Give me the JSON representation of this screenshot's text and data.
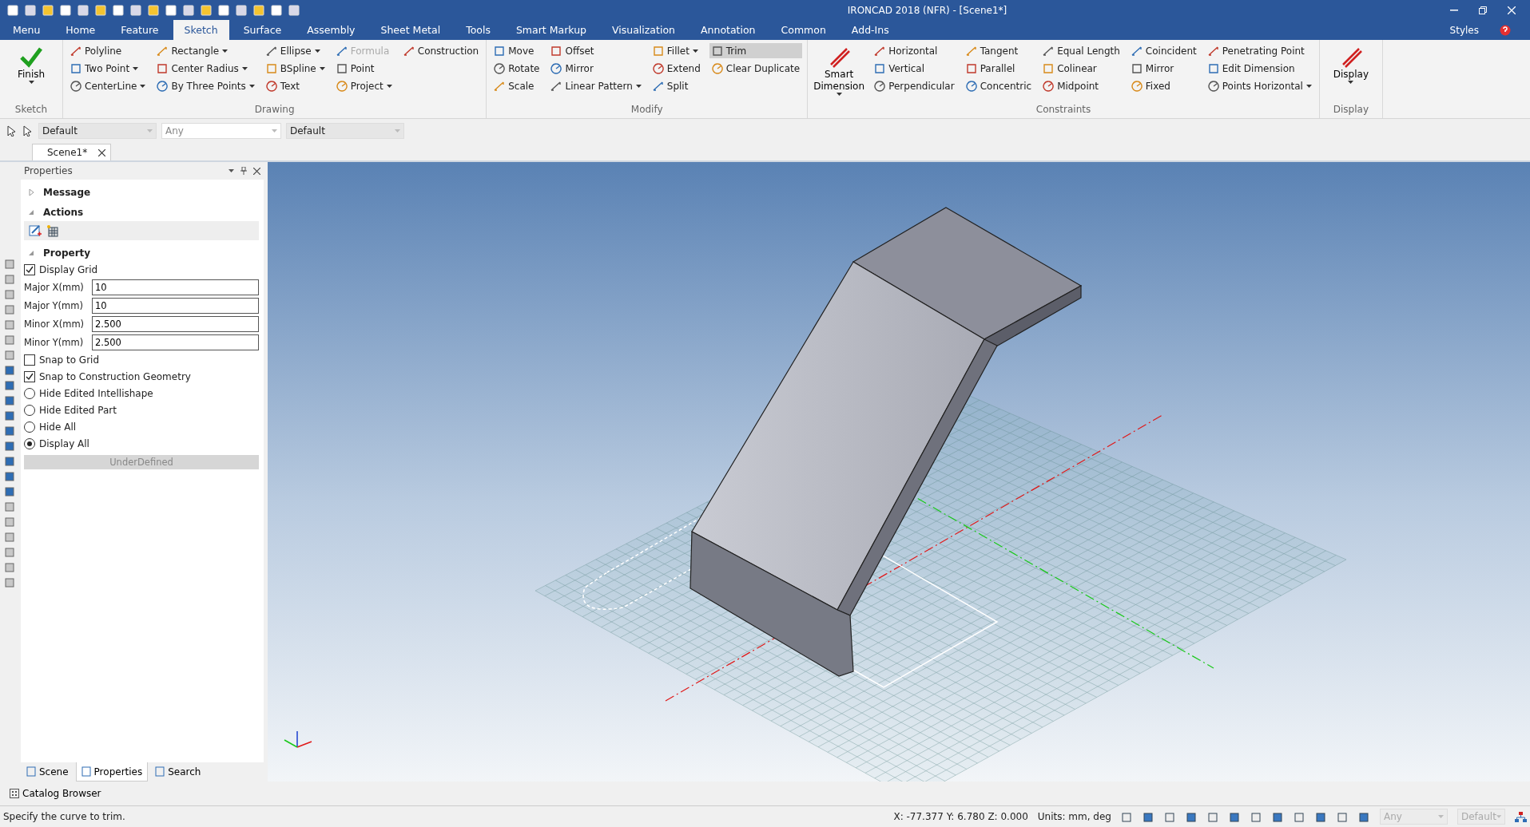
{
  "window": {
    "title": "IRONCAD 2018 (NFR) - [Scene1*]"
  },
  "menu_tabs": [
    {
      "label": "Menu",
      "selected": false
    },
    {
      "label": "Home",
      "selected": false
    },
    {
      "label": "Feature",
      "selected": false
    },
    {
      "label": "Sketch",
      "selected": true
    },
    {
      "label": "Surface",
      "selected": false
    },
    {
      "label": "Assembly",
      "selected": false
    },
    {
      "label": "Sheet Metal",
      "selected": false
    },
    {
      "label": "Tools",
      "selected": false
    },
    {
      "label": "Smart Markup",
      "selected": false
    },
    {
      "label": "Visualization",
      "selected": false
    },
    {
      "label": "Annotation",
      "selected": false
    },
    {
      "label": "Common",
      "selected": false
    },
    {
      "label": "Add-Ins",
      "selected": false
    }
  ],
  "styles_menu": {
    "label": "Styles"
  },
  "ribbon": [
    {
      "label": "Sketch",
      "columns": [
        {
          "kind": "large",
          "label": "Finish",
          "dropdown": true
        }
      ]
    },
    {
      "label": "Drawing",
      "columns": [
        {
          "kind": "stack",
          "items": [
            {
              "label": "Polyline",
              "dropdown": false,
              "disabled": false,
              "selected": false
            },
            {
              "label": "Two Point",
              "dropdown": true,
              "disabled": false,
              "selected": false
            },
            {
              "label": "CenterLine",
              "dropdown": true,
              "disabled": false,
              "selected": false
            }
          ]
        },
        {
          "kind": "stack",
          "items": [
            {
              "label": "Rectangle",
              "dropdown": true,
              "disabled": false,
              "selected": false
            },
            {
              "label": "Center Radius",
              "dropdown": true,
              "disabled": false,
              "selected": false
            },
            {
              "label": "By Three Points",
              "dropdown": true,
              "disabled": false,
              "selected": false
            }
          ]
        },
        {
          "kind": "stack",
          "items": [
            {
              "label": "Ellipse",
              "dropdown": true,
              "disabled": false,
              "selected": false
            },
            {
              "label": "BSpline",
              "dropdown": true,
              "disabled": false,
              "selected": false
            },
            {
              "label": "Text",
              "dropdown": false,
              "disabled": false,
              "selected": false
            }
          ]
        },
        {
          "kind": "stack",
          "items": [
            {
              "label": "Formula",
              "dropdown": false,
              "disabled": true,
              "selected": false
            },
            {
              "label": "Point",
              "dropdown": false,
              "disabled": false,
              "selected": false
            },
            {
              "label": "Project",
              "dropdown": true,
              "disabled": false,
              "selected": false
            }
          ]
        },
        {
          "kind": "stack",
          "items": [
            {
              "label": "Construction",
              "dropdown": false,
              "disabled": false,
              "selected": false
            }
          ]
        }
      ]
    },
    {
      "label": "Modify",
      "columns": [
        {
          "kind": "stack",
          "items": [
            {
              "label": "Move",
              "dropdown": false,
              "disabled": false,
              "selected": false
            },
            {
              "label": "Rotate",
              "dropdown": false,
              "disabled": false,
              "selected": false
            },
            {
              "label": "Scale",
              "dropdown": false,
              "disabled": false,
              "selected": false
            }
          ]
        },
        {
          "kind": "stack",
          "items": [
            {
              "label": "Offset",
              "dropdown": false,
              "disabled": false,
              "selected": false
            },
            {
              "label": "Mirror",
              "dropdown": false,
              "disabled": false,
              "selected": false
            },
            {
              "label": "Linear Pattern",
              "dropdown": true,
              "disabled": false,
              "selected": false
            }
          ]
        },
        {
          "kind": "stack",
          "items": [
            {
              "label": "Fillet",
              "dropdown": true,
              "disabled": false,
              "selected": false
            },
            {
              "label": "Extend",
              "dropdown": false,
              "disabled": false,
              "selected": false
            },
            {
              "label": "Split",
              "dropdown": false,
              "disabled": false,
              "selected": false
            }
          ]
        },
        {
          "kind": "stack",
          "items": [
            {
              "label": "Trim",
              "dropdown": false,
              "disabled": false,
              "selected": true
            },
            {
              "label": "Clear Duplicate",
              "dropdown": false,
              "disabled": false,
              "selected": false
            }
          ]
        }
      ]
    },
    {
      "label": "Constraints",
      "columns": [
        {
          "kind": "large",
          "label": "Smart Dimension",
          "dropdown": true
        },
        {
          "kind": "stack",
          "items": [
            {
              "label": "Horizontal",
              "dropdown": false,
              "disabled": false,
              "selected": false
            },
            {
              "label": "Vertical",
              "dropdown": false,
              "disabled": false,
              "selected": false
            },
            {
              "label": "Perpendicular",
              "dropdown": false,
              "disabled": false,
              "selected": false
            }
          ]
        },
        {
          "kind": "stack",
          "items": [
            {
              "label": "Tangent",
              "dropdown": false,
              "disabled": false,
              "selected": false
            },
            {
              "label": "Parallel",
              "dropdown": false,
              "disabled": false,
              "selected": false
            },
            {
              "label": "Concentric",
              "dropdown": false,
              "disabled": false,
              "selected": false
            }
          ]
        },
        {
          "kind": "stack",
          "items": [
            {
              "label": "Equal Length",
              "dropdown": false,
              "disabled": false,
              "selected": false
            },
            {
              "label": "Colinear",
              "dropdown": false,
              "disabled": false,
              "selected": false
            },
            {
              "label": "Midpoint",
              "dropdown": false,
              "disabled": false,
              "selected": false
            }
          ]
        },
        {
          "kind": "stack",
          "items": [
            {
              "label": "Coincident",
              "dropdown": false,
              "disabled": false,
              "selected": false
            },
            {
              "label": "Mirror",
              "dropdown": false,
              "disabled": false,
              "selected": false
            },
            {
              "label": "Fixed",
              "dropdown": false,
              "disabled": false,
              "selected": false
            }
          ]
        },
        {
          "kind": "stack",
          "items": [
            {
              "label": "Penetrating Point",
              "dropdown": false,
              "disabled": false,
              "selected": false
            },
            {
              "label": "Edit Dimension",
              "dropdown": false,
              "disabled": false,
              "selected": false
            },
            {
              "label": "Points Horizontal",
              "dropdown": true,
              "disabled": false,
              "selected": false
            }
          ]
        }
      ]
    },
    {
      "label": "Display",
      "columns": [
        {
          "kind": "large",
          "label": "Display",
          "dropdown": true
        }
      ]
    }
  ],
  "selection_toolbar": [
    {
      "value": "Default"
    },
    {
      "value": "Any"
    },
    {
      "value": "Default"
    }
  ],
  "document_tab": {
    "label": "Scene1*"
  },
  "properties": {
    "title": "Properties",
    "rows": [
      {
        "kind": "section",
        "label": "Message",
        "expanded": false
      },
      {
        "kind": "section",
        "label": "Actions",
        "expanded": true
      },
      {
        "kind": "actions"
      },
      {
        "kind": "section",
        "label": "Property",
        "expanded": true
      },
      {
        "kind": "checkbox",
        "label": "Display Grid",
        "checked": true
      },
      {
        "kind": "field",
        "label": "Major X(mm)",
        "value": "10"
      },
      {
        "kind": "field",
        "label": "Major Y(mm)",
        "value": "10"
      },
      {
        "kind": "field",
        "label": "Minor X(mm)",
        "value": "2.500"
      },
      {
        "kind": "field",
        "label": "Minor Y(mm)",
        "value": "2.500"
      },
      {
        "kind": "checkbox",
        "label": "Snap to Grid",
        "checked": false
      },
      {
        "kind": "checkbox",
        "label": "Snap to Construction Geometry",
        "checked": true
      },
      {
        "kind": "radio",
        "label": "Hide Edited Intellishape",
        "selected": false
      },
      {
        "kind": "radio",
        "label": "Hide Edited Part",
        "selected": false
      },
      {
        "kind": "radio",
        "label": "Hide All",
        "selected": false
      },
      {
        "kind": "radio",
        "label": "Display All",
        "selected": true
      },
      {
        "kind": "button",
        "label": "UnderDefined",
        "disabled": true
      }
    ]
  },
  "panel_tabs": [
    {
      "label": "Scene",
      "selected": false
    },
    {
      "label": "Properties",
      "selected": true
    },
    {
      "label": "Search",
      "selected": false
    }
  ],
  "catalog_browser": {
    "label": "Catalog Browser"
  },
  "status_bar": {
    "message": "Specify the curve to trim.",
    "coordinates": "X: -77.377 Y: 6.780 Z: 0.000",
    "units": "Units: mm, deg",
    "selectors": [
      {
        "value": "Any",
        "disabled": true
      },
      {
        "value": "Default",
        "disabled": true
      }
    ]
  }
}
